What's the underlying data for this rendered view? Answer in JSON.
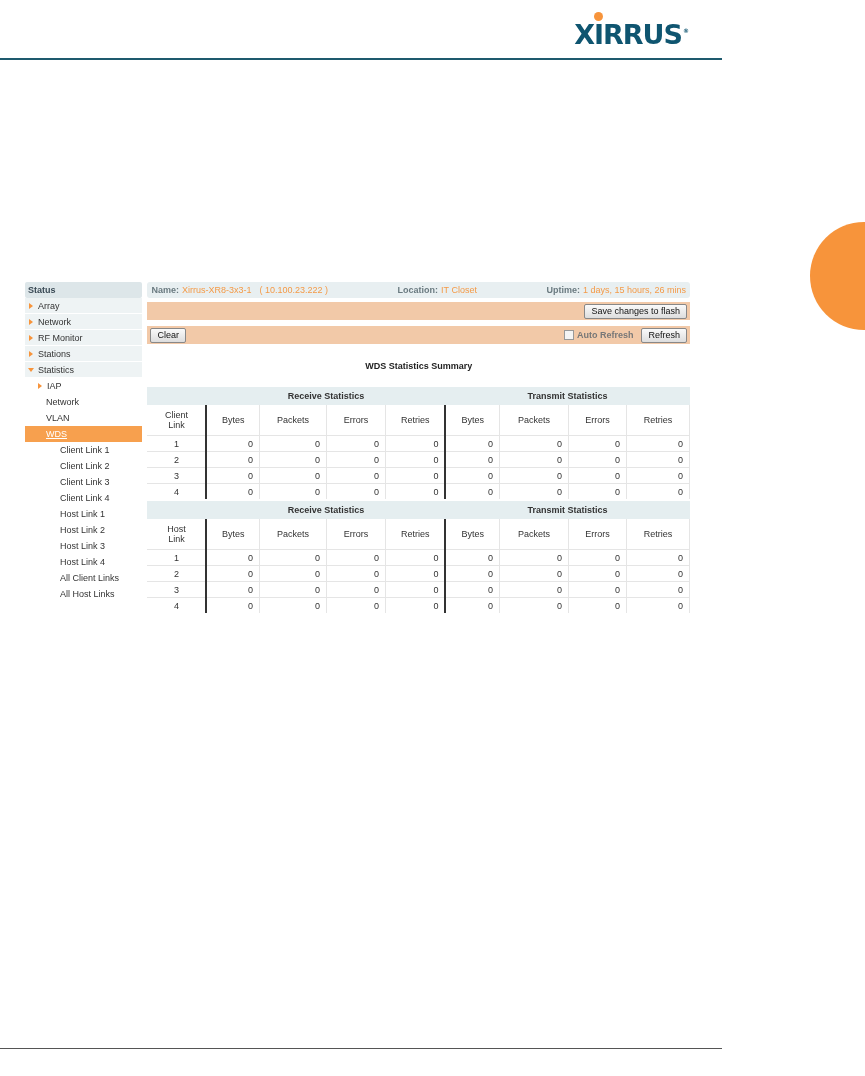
{
  "logo": {
    "text": "XIRRUS",
    "mark": "®"
  },
  "sidebar": {
    "title": "Status",
    "items": [
      {
        "label": "Array",
        "expanded": false,
        "selected": false
      },
      {
        "label": "Network",
        "expanded": false,
        "selected": false
      },
      {
        "label": "RF Monitor",
        "expanded": false,
        "selected": false
      },
      {
        "label": "Stations",
        "expanded": false,
        "selected": false
      },
      {
        "label": "Statistics",
        "expanded": true,
        "selected": false,
        "children": [
          {
            "label": "IAP",
            "expanded": false,
            "selected": false
          },
          {
            "label": "Network",
            "selected": false
          },
          {
            "label": "VLAN",
            "selected": false
          },
          {
            "label": "WDS",
            "selected": true,
            "children": [
              {
                "label": "Client Link 1",
                "selected": false
              },
              {
                "label": "Client Link 2",
                "selected": false
              },
              {
                "label": "Client Link 3",
                "selected": false
              },
              {
                "label": "Client Link 4",
                "selected": false
              },
              {
                "label": "Host Link 1",
                "selected": false
              },
              {
                "label": "Host Link 2",
                "selected": false
              },
              {
                "label": "Host Link 3",
                "selected": false
              },
              {
                "label": "Host Link 4",
                "selected": false
              },
              {
                "label": "All Client Links",
                "selected": false
              },
              {
                "label": "All Host Links",
                "selected": false
              }
            ]
          }
        ]
      }
    ]
  },
  "info_bar": {
    "name_label": "Name:",
    "name": "Xirrus-XR8-3x3-1",
    "ip": "( 10.100.23.222 )",
    "location_label": "Location:",
    "location": "IT Closet",
    "uptime_label": "Uptime:",
    "uptime": "1 days, 15 hours, 26 mins"
  },
  "save_button": "Save changes to flash",
  "toolbar": {
    "clear_button": "Clear",
    "auto_refresh": {
      "label": "Auto Refresh",
      "checked": false
    },
    "refresh_button": "Refresh"
  },
  "title": "WDS Statistics Summary",
  "tables": [
    {
      "groups": [
        "Receive Statistics",
        "Transmit Statistics"
      ],
      "columns": [
        "Client Link",
        "Bytes",
        "Packets",
        "Errors",
        "Retries",
        "Bytes",
        "Packets",
        "Errors",
        "Retries"
      ],
      "rows": [
        [
          "1",
          "0",
          "0",
          "0",
          "0",
          "0",
          "0",
          "0",
          "0"
        ],
        [
          "2",
          "0",
          "0",
          "0",
          "0",
          "0",
          "0",
          "0",
          "0"
        ],
        [
          "3",
          "0",
          "0",
          "0",
          "0",
          "0",
          "0",
          "0",
          "0"
        ],
        [
          "4",
          "0",
          "0",
          "0",
          "0",
          "0",
          "0",
          "0",
          "0"
        ]
      ]
    },
    {
      "groups": [
        "Receive Statistics",
        "Transmit Statistics"
      ],
      "columns": [
        "Host Link",
        "Bytes",
        "Packets",
        "Errors",
        "Retries",
        "Bytes",
        "Packets",
        "Errors",
        "Retries"
      ],
      "rows": [
        [
          "1",
          "0",
          "0",
          "0",
          "0",
          "0",
          "0",
          "0",
          "0"
        ],
        [
          "2",
          "0",
          "0",
          "0",
          "0",
          "0",
          "0",
          "0",
          "0"
        ],
        [
          "3",
          "0",
          "0",
          "0",
          "0",
          "0",
          "0",
          "0",
          "0"
        ],
        [
          "4",
          "0",
          "0",
          "0",
          "0",
          "0",
          "0",
          "0",
          "0"
        ]
      ]
    }
  ]
}
